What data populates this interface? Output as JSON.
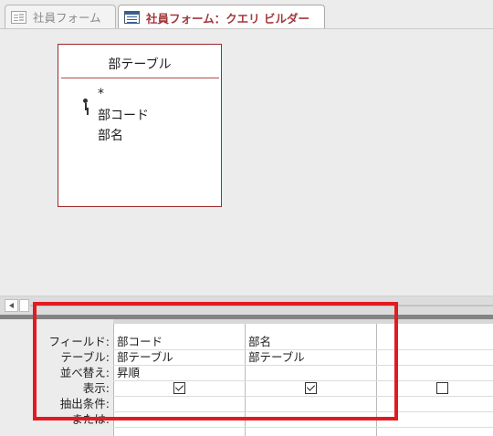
{
  "tabs": [
    {
      "label": "社員フォーム",
      "icon": "form-icon",
      "active": false
    },
    {
      "label": "社員フォーム：クエリ ビルダー",
      "icon": "query-icon",
      "active": true
    }
  ],
  "table_box": {
    "title": "部テーブル",
    "fields": [
      {
        "label": "*",
        "key": false
      },
      {
        "label": "部コード",
        "key": true
      },
      {
        "label": "部名",
        "key": false
      }
    ]
  },
  "grid": {
    "row_labels": [
      "フィールド:",
      "テーブル:",
      "並べ替え:",
      "表示:",
      "抽出条件:",
      "または:"
    ],
    "columns": [
      {
        "field": "部コード",
        "table": "部テーブル",
        "sort": "昇順",
        "show": true
      },
      {
        "field": "部名",
        "table": "部テーブル",
        "sort": "",
        "show": true
      },
      {
        "field": "",
        "table": "",
        "sort": "",
        "show": false
      }
    ]
  },
  "colors": {
    "accent": "#a4373a",
    "highlight": "#e21a22",
    "table_border": "#9d2b2b"
  }
}
